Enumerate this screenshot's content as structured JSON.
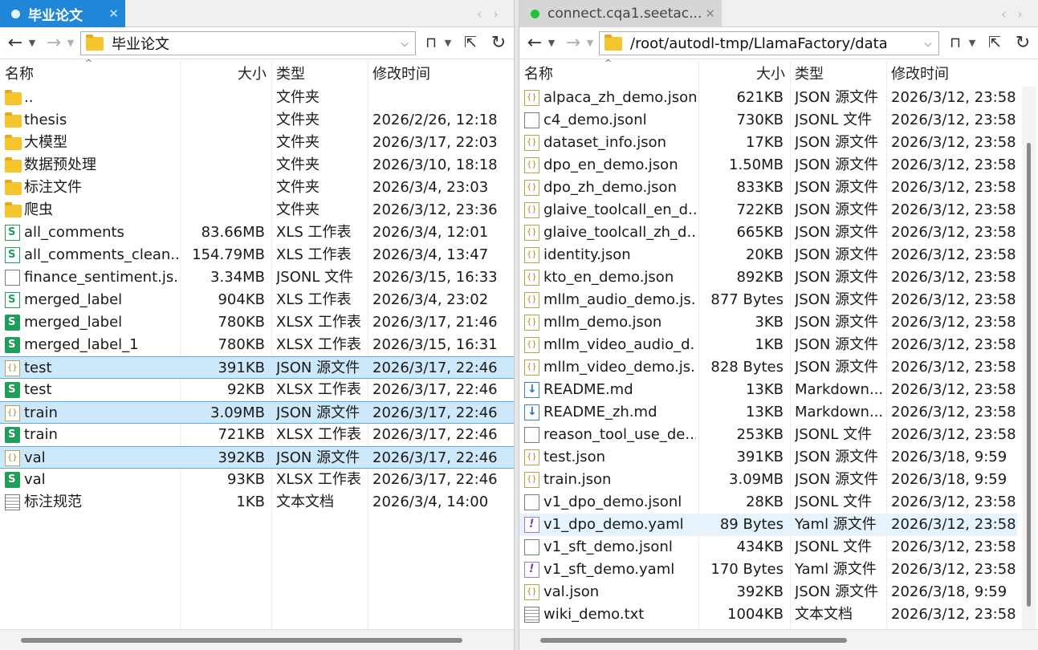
{
  "left": {
    "tab": {
      "title": "毕业论文",
      "close": "✕"
    },
    "toolbar": {
      "back": "←",
      "forward": "→",
      "path": "毕业论文",
      "bookmark": "🔖",
      "refresh": "↻"
    },
    "columns": {
      "name": "名称",
      "size": "大小",
      "type": "类型",
      "modified": "修改时间"
    },
    "files": [
      {
        "name": "..",
        "size": "",
        "type": "文件夹",
        "modified": "",
        "icon": "folder-icon"
      },
      {
        "name": "thesis",
        "size": "",
        "type": "文件夹",
        "modified": "2026/2/26, 12:18",
        "icon": "folder-icon"
      },
      {
        "name": "大模型",
        "size": "",
        "type": "文件夹",
        "modified": "2026/3/17, 22:03",
        "icon": "folder-icon"
      },
      {
        "name": "数据预处理",
        "size": "",
        "type": "文件夹",
        "modified": "2026/3/10, 18:18",
        "icon": "folder-icon"
      },
      {
        "name": "标注文件",
        "size": "",
        "type": "文件夹",
        "modified": "2026/3/4, 23:03",
        "icon": "folder-icon"
      },
      {
        "name": "爬虫",
        "size": "",
        "type": "文件夹",
        "modified": "2026/3/12, 23:36",
        "icon": "folder-icon"
      },
      {
        "name": "all_comments",
        "size": "83.66MB",
        "type": "XLS 工作表",
        "modified": "2026/3/4, 12:01",
        "icon": "xls-icon"
      },
      {
        "name": "all_comments_clean...",
        "size": "154.79MB",
        "type": "XLS 工作表",
        "modified": "2026/3/4, 13:47",
        "icon": "xls-icon"
      },
      {
        "name": "finance_sentiment.js...",
        "size": "3.34MB",
        "type": "JSONL 文件",
        "modified": "2026/3/15, 16:33",
        "icon": "document-icon"
      },
      {
        "name": "merged_label",
        "size": "904KB",
        "type": "XLS 工作表",
        "modified": "2026/3/4, 23:02",
        "icon": "xls-icon"
      },
      {
        "name": "merged_label",
        "size": "780KB",
        "type": "XLSX 工作表",
        "modified": "2026/3/17, 21:46",
        "icon": "xlsx-icon"
      },
      {
        "name": "merged_label_1",
        "size": "780KB",
        "type": "XLSX 工作表",
        "modified": "2026/3/15, 16:31",
        "icon": "xlsx-icon"
      },
      {
        "name": "test",
        "size": "391KB",
        "type": "JSON 源文件",
        "modified": "2026/3/17, 22:46",
        "icon": "json-icon",
        "selected": true
      },
      {
        "name": "test",
        "size": "92KB",
        "type": "XLSX 工作表",
        "modified": "2026/3/17, 22:46",
        "icon": "xlsx-icon"
      },
      {
        "name": "train",
        "size": "3.09MB",
        "type": "JSON 源文件",
        "modified": "2026/3/17, 22:46",
        "icon": "json-icon",
        "selected": true
      },
      {
        "name": "train",
        "size": "721KB",
        "type": "XLSX 工作表",
        "modified": "2026/3/17, 22:46",
        "icon": "xlsx-icon"
      },
      {
        "name": "val",
        "size": "392KB",
        "type": "JSON 源文件",
        "modified": "2026/3/17, 22:46",
        "icon": "json-icon",
        "selected": true
      },
      {
        "name": "val",
        "size": "93KB",
        "type": "XLSX 工作表",
        "modified": "2026/3/17, 22:46",
        "icon": "xlsx-icon"
      },
      {
        "name": "标注规范",
        "size": "1KB",
        "type": "文本文档",
        "modified": "2026/3/4, 14:00",
        "icon": "text-document-icon"
      }
    ]
  },
  "right": {
    "tab": {
      "title": "connect.cqa1.seetac...",
      "close": "✕"
    },
    "toolbar": {
      "back": "←",
      "forward": "→",
      "path": "/root/autodl-tmp/LlamaFactory/data",
      "bookmark": "🔖",
      "refresh": "↻"
    },
    "columns": {
      "name": "名称",
      "size": "大小",
      "type": "类型",
      "modified": "修改时间"
    },
    "files": [
      {
        "name": "alpaca_zh_demo.json",
        "size": "621KB",
        "type": "JSON 源文件",
        "modified": "2026/3/12, 23:58",
        "icon": "json-icon"
      },
      {
        "name": "c4_demo.jsonl",
        "size": "730KB",
        "type": "JSONL 文件",
        "modified": "2026/3/12, 23:58",
        "icon": "document-icon"
      },
      {
        "name": "dataset_info.json",
        "size": "17KB",
        "type": "JSON 源文件",
        "modified": "2026/3/12, 23:58",
        "icon": "json-icon"
      },
      {
        "name": "dpo_en_demo.json",
        "size": "1.50MB",
        "type": "JSON 源文件",
        "modified": "2026/3/12, 23:58",
        "icon": "json-icon"
      },
      {
        "name": "dpo_zh_demo.json",
        "size": "833KB",
        "type": "JSON 源文件",
        "modified": "2026/3/12, 23:58",
        "icon": "json-icon"
      },
      {
        "name": "glaive_toolcall_en_d...",
        "size": "722KB",
        "type": "JSON 源文件",
        "modified": "2026/3/12, 23:58",
        "icon": "json-icon"
      },
      {
        "name": "glaive_toolcall_zh_d...",
        "size": "665KB",
        "type": "JSON 源文件",
        "modified": "2026/3/12, 23:58",
        "icon": "json-icon"
      },
      {
        "name": "identity.json",
        "size": "20KB",
        "type": "JSON 源文件",
        "modified": "2026/3/12, 23:58",
        "icon": "json-icon"
      },
      {
        "name": "kto_en_demo.json",
        "size": "892KB",
        "type": "JSON 源文件",
        "modified": "2026/3/12, 23:58",
        "icon": "json-icon"
      },
      {
        "name": "mllm_audio_demo.js...",
        "size": "877 Bytes",
        "type": "JSON 源文件",
        "modified": "2026/3/12, 23:58",
        "icon": "json-icon"
      },
      {
        "name": "mllm_demo.json",
        "size": "3KB",
        "type": "JSON 源文件",
        "modified": "2026/3/12, 23:58",
        "icon": "json-icon"
      },
      {
        "name": "mllm_video_audio_d...",
        "size": "1KB",
        "type": "JSON 源文件",
        "modified": "2026/3/12, 23:58",
        "icon": "json-icon"
      },
      {
        "name": "mllm_video_demo.js...",
        "size": "828 Bytes",
        "type": "JSON 源文件",
        "modified": "2026/3/12, 23:58",
        "icon": "json-icon"
      },
      {
        "name": "README.md",
        "size": "13KB",
        "type": "Markdown...",
        "modified": "2026/3/12, 23:58",
        "icon": "markdown-icon"
      },
      {
        "name": "README_zh.md",
        "size": "13KB",
        "type": "Markdown...",
        "modified": "2026/3/12, 23:58",
        "icon": "markdown-icon"
      },
      {
        "name": "reason_tool_use_de...",
        "size": "253KB",
        "type": "JSONL 文件",
        "modified": "2026/3/12, 23:58",
        "icon": "document-icon"
      },
      {
        "name": "test.json",
        "size": "391KB",
        "type": "JSON 源文件",
        "modified": "2026/3/18, 9:59",
        "icon": "json-icon"
      },
      {
        "name": "train.json",
        "size": "3.09MB",
        "type": "JSON 源文件",
        "modified": "2026/3/18, 9:59",
        "icon": "json-icon"
      },
      {
        "name": "v1_dpo_demo.jsonl",
        "size": "28KB",
        "type": "JSONL 文件",
        "modified": "2026/3/12, 23:58",
        "icon": "document-icon"
      },
      {
        "name": "v1_dpo_demo.yaml",
        "size": "89 Bytes",
        "type": "Yaml 源文件",
        "modified": "2026/3/12, 23:58",
        "icon": "yaml-icon",
        "hover": true
      },
      {
        "name": "v1_sft_demo.jsonl",
        "size": "434KB",
        "type": "JSONL 文件",
        "modified": "2026/3/12, 23:58",
        "icon": "document-icon"
      },
      {
        "name": "v1_sft_demo.yaml",
        "size": "170 Bytes",
        "type": "Yaml 源文件",
        "modified": "2026/3/12, 23:58",
        "icon": "yaml-icon"
      },
      {
        "name": "val.json",
        "size": "392KB",
        "type": "JSON 源文件",
        "modified": "2026/3/18, 9:59",
        "icon": "json-icon"
      },
      {
        "name": "wiki_demo.txt",
        "size": "1004KB",
        "type": "文本文档",
        "modified": "2026/3/12, 23:58",
        "icon": "text-document-icon"
      }
    ]
  },
  "colors": {
    "active_tab": "#1f86d8",
    "selection": "#cde8fa",
    "selection_border": "#5aa8e6",
    "connected_dot": "#22c33a"
  }
}
